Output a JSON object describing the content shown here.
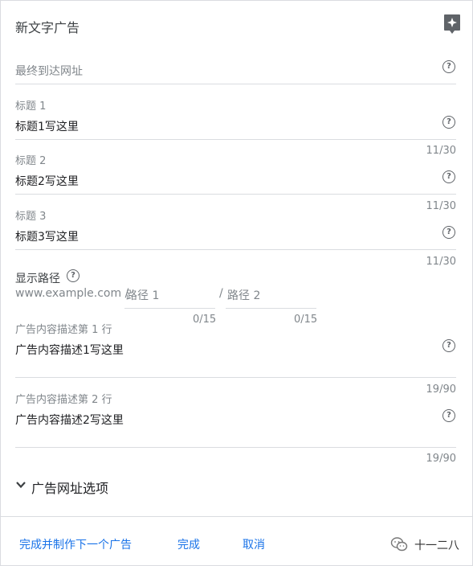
{
  "header": {
    "title": "新文字广告"
  },
  "final_url": {
    "placeholder": "最终到达网址"
  },
  "headline1": {
    "label": "标题 1",
    "value": "标题1写这里",
    "counter": "11/30"
  },
  "headline2": {
    "label": "标题 2",
    "value": "标题2写这里",
    "counter": "11/30"
  },
  "headline3": {
    "label": "标题 3",
    "value": "标题3写这里",
    "counter": "11/30"
  },
  "display_path": {
    "label": "显示路径",
    "domain": "www.example.com /",
    "path1_placeholder": "路径 1",
    "separator": "/",
    "path2_placeholder": "路径 2",
    "path1_counter": "0/15",
    "path2_counter": "0/15"
  },
  "description1": {
    "label": "广告内容描述第 1 行",
    "value": "广告内容描述1写这里",
    "counter": "19/90"
  },
  "description2": {
    "label": "广告内容描述第 2 行",
    "value": "广告内容描述2写这里",
    "counter": "19/90"
  },
  "url_options": {
    "label": "广告网址选项"
  },
  "footer": {
    "save_next": "完成并制作下一个广告",
    "done": "完成",
    "cancel": "取消"
  },
  "watermark": {
    "text": "十一二八"
  },
  "colors": {
    "accent": "#1a73e8",
    "divider": "#dadce0",
    "muted": "#80868b"
  }
}
